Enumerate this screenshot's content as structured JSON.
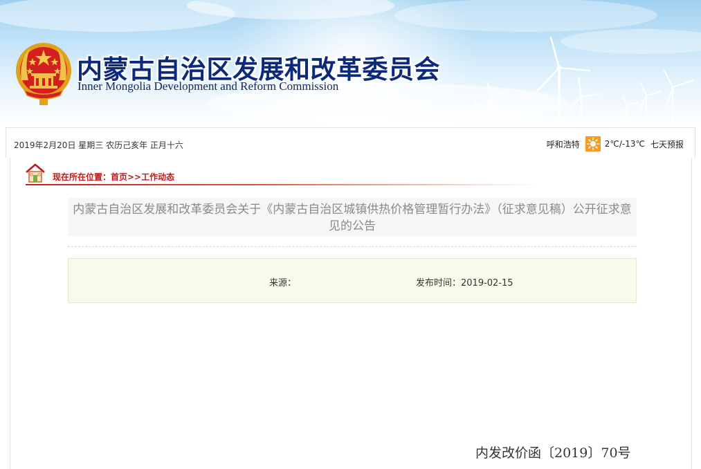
{
  "header": {
    "title": "内蒙古自治区发展和改革委员会",
    "subtitle": "Inner Mongolia Development  and Reform Commission"
  },
  "info_bar": {
    "date": "2019年2月20日  星期三  农历己亥年  正月十六",
    "weather": {
      "city": "呼和浩特",
      "icon": "sunny-icon",
      "temperature": "2℃/-13℃",
      "forecast_link": "七天预报"
    }
  },
  "breadcrumb": {
    "text": "现在所在位置：首页>>工作动态"
  },
  "article": {
    "title": "内蒙古自治区发展和改革委员会关于《内蒙古自治区城镇供热价格管理暂行办法》（征求意见稿）公开征求意见的公告",
    "source": "来源：",
    "published": "发布时间：2019-02-15",
    "doc_number": "内发改价函〔2019〕70号"
  },
  "colors": {
    "title_blue": "#0d2a7a",
    "breadcrumb_red": "#c01818",
    "weather_orange": "#f39a1f"
  }
}
